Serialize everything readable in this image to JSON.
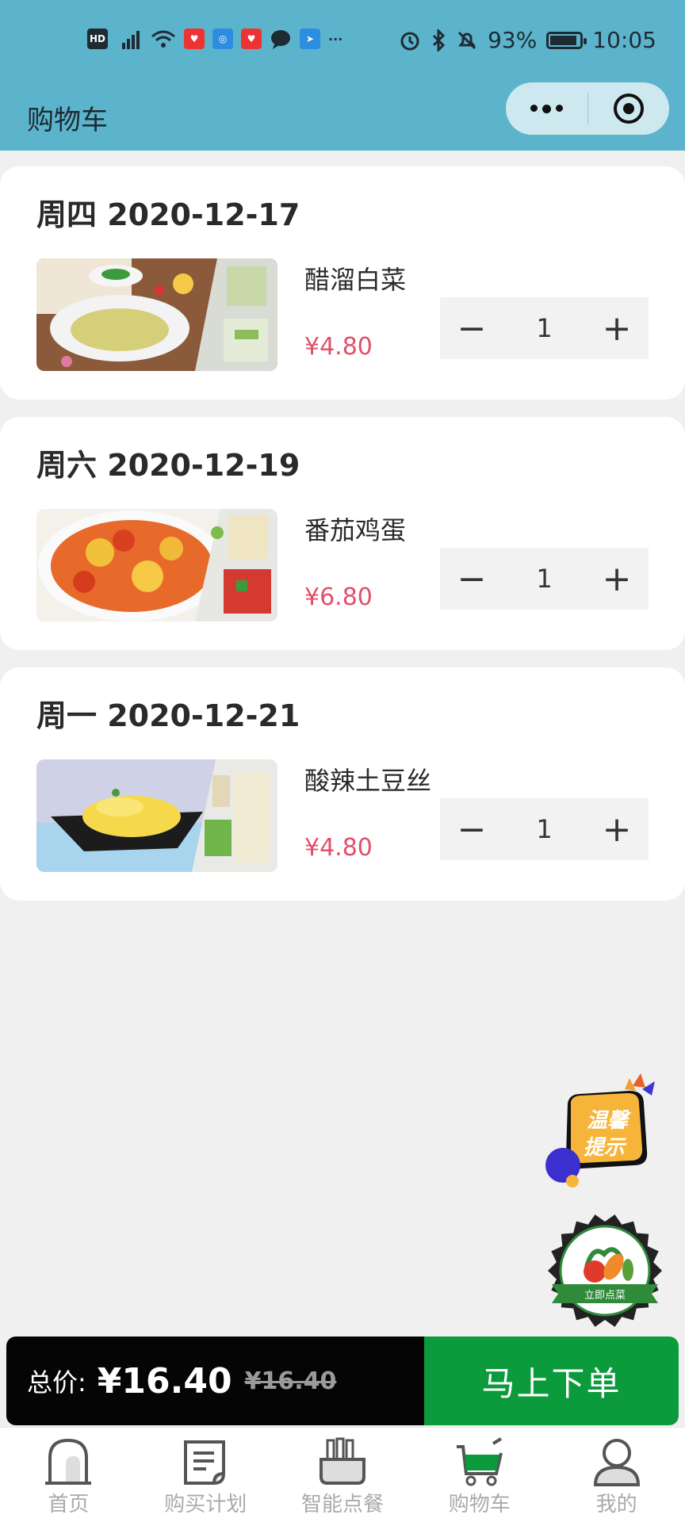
{
  "status_bar": {
    "left_icons": [
      "hd-icon",
      "signal-4g-icon",
      "wifi-icon",
      "app-icon-1",
      "app-icon-2",
      "app-icon-3",
      "chat-icon",
      "app-icon-4"
    ],
    "more": "···",
    "battery_percent": "93%",
    "battery_level": 0.93,
    "time": "10:05"
  },
  "nav": {
    "title": "购物车"
  },
  "cart": [
    {
      "date": "周四 2020-12-17",
      "name": "醋溜白菜",
      "price": "¥4.80",
      "qty": "1"
    },
    {
      "date": "周六 2020-12-19",
      "name": "番茄鸡蛋",
      "price": "¥6.80",
      "qty": "1"
    },
    {
      "date": "周一 2020-12-21",
      "name": "酸辣土豆丝",
      "price": "¥4.80",
      "qty": "1"
    }
  ],
  "stepper": {
    "minus": "−",
    "plus": "+"
  },
  "badges": {
    "tip_line1": "温馨",
    "tip_line2": "提示",
    "order_now": "立即点菜"
  },
  "summary": {
    "total_label": "总价:",
    "total_price": "¥16.40",
    "original_price": "¥16.40",
    "order_button": "马上下单"
  },
  "tabs": [
    {
      "label": "首页",
      "icon": "home-icon"
    },
    {
      "label": "购买计划",
      "icon": "plan-icon"
    },
    {
      "label": "智能点餐",
      "icon": "smart-order-icon"
    },
    {
      "label": "购物车",
      "icon": "cart-icon"
    },
    {
      "label": "我的",
      "icon": "profile-icon"
    }
  ],
  "colors": {
    "header": "#5bb4cc",
    "price": "#e0506a",
    "order_button": "#0b9a3c",
    "summary_bar": "#050505",
    "active_tab_icon": "#0b9a3c"
  }
}
